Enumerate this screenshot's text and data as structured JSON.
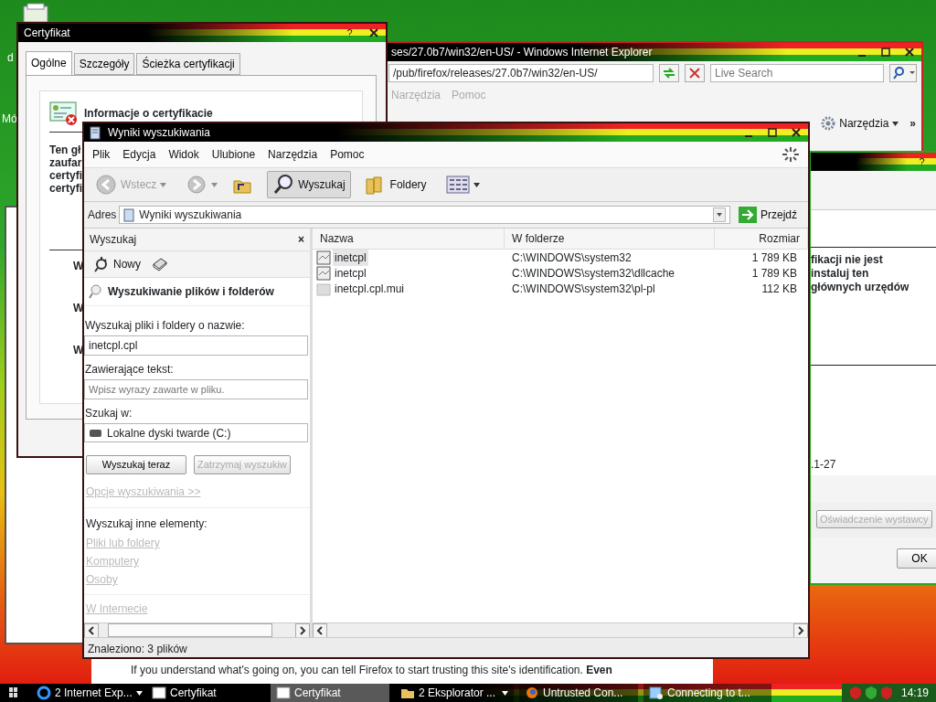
{
  "desktop": {
    "icon_labels": [
      "d",
      "Mó"
    ]
  },
  "ie_window": {
    "title": "ses/27.0b7/win32/en-US/ - Windows Internet Explorer",
    "address": "/pub/firefox/releases/27.0b7/win32/en-US/",
    "search_placeholder": "Live Search",
    "menu": [
      {
        "label": "Narzędzia",
        "disabled": true
      },
      {
        "label": "Pomoc",
        "disabled": true
      }
    ],
    "tools_button": "Narzędzia",
    "chevron": "»"
  },
  "cert_right": {
    "help": "?",
    "text_lines": [
      "fikacji nie jest",
      "instaluj ten",
      "głównych urzędów"
    ],
    "date": ".1-27",
    "issuer_button": "Oświadczenie wystawcy",
    "ok_button": "OK"
  },
  "cert_window": {
    "title": "Certyfikat",
    "help": "?",
    "tabs": [
      {
        "label": "Ogólne",
        "selected": true
      },
      {
        "label": "Szczegóły",
        "selected": false
      },
      {
        "label": "Ścieżka certyfikacji",
        "selected": false
      }
    ],
    "heading": "Informacje o certyfikacie",
    "text_lines": [
      "Ten gł",
      "zaufar",
      "certyfi",
      "certyfi"
    ],
    "field_labels": [
      "W",
      "W",
      "W"
    ]
  },
  "search_window": {
    "title": "Wyniki wyszukiwania",
    "menu": [
      "Plik",
      "Edycja",
      "Widok",
      "Ulubione",
      "Narzędzia",
      "Pomoc"
    ],
    "toolbar": [
      {
        "kind": "back",
        "label": "Wstecz",
        "disabled": true,
        "selected": false
      },
      {
        "kind": "forward",
        "disabled": true,
        "selected": false
      },
      {
        "kind": "up",
        "disabled": false,
        "selected": false
      },
      {
        "kind": "search",
        "label": "Wyszukaj",
        "disabled": false,
        "selected": true
      },
      {
        "kind": "folders",
        "label": "Foldery",
        "disabled": false,
        "selected": false
      },
      {
        "kind": "views",
        "disabled": false,
        "selected": false
      }
    ],
    "address_label": "Adres",
    "address": "Wyniki wyszukiwania",
    "go_button": "Przejdź",
    "pane": {
      "title": "Wyszukaj",
      "close": "×",
      "new_button": "Nowy",
      "heading": "Wyszukiwanie plików i folderów",
      "name_label": "Wyszukaj pliki i foldery o nazwie:",
      "name_value": "inetcpl.cpl",
      "text_label": "Zawierające tekst:",
      "text_placeholder": "Wpisz wyrazy zawarte w pliku.",
      "look_in_label": "Szukaj w:",
      "look_in_value": "Lokalne dyski twarde (C:)",
      "search_button": {
        "label": "Wyszukaj teraz",
        "disabled": false
      },
      "stop_button": {
        "label": "Zatrzymaj wyszukiw",
        "disabled": true
      },
      "options_link": {
        "label": "Opcje wyszukiwania >>",
        "disabled": true
      },
      "other_label": "Wyszukaj inne elementy:",
      "other_links": [
        {
          "label": "Pliki lub foldery",
          "disabled": true
        },
        {
          "label": "Komputery",
          "disabled": true
        },
        {
          "label": "Osoby",
          "disabled": true
        }
      ],
      "internet_link": {
        "label": "W Internecie",
        "disabled": true
      }
    },
    "table": {
      "columns": [
        "Nazwa",
        "W folderze",
        "Rozmiar"
      ],
      "rows": [
        {
          "name": "inetcpl",
          "folder": "C:\\WINDOWS\\system32",
          "size": "1 789 KB",
          "kind": "cpl",
          "selected": true
        },
        {
          "name": "inetcpl",
          "folder": "C:\\WINDOWS\\system32\\dllcache",
          "size": "1 789 KB",
          "kind": "cpl",
          "selected": false
        },
        {
          "name": "inetcpl.cpl.mui",
          "folder": "C:\\WINDOWS\\system32\\pl-pl",
          "size": "112 KB",
          "kind": "mui",
          "selected": false
        }
      ]
    },
    "status_bar": "Znaleziono: 3 plików"
  },
  "firefox_page": {
    "text": "If you understand what's going on, you can tell Firefox to start trusting this site's identification. **Even**"
  },
  "taskbar": {
    "buttons": [
      {
        "label": "2 Internet Exp...",
        "kind": "ie",
        "grouped": true,
        "selected": false
      },
      {
        "label": "Certyfikat",
        "kind": "window",
        "grouped": false,
        "selected": false
      },
      {
        "label": "Certyfikat",
        "kind": "window",
        "grouped": false,
        "selected": true
      },
      {
        "label": "2 Eksplorator ...",
        "kind": "folder",
        "grouped": true,
        "selected": false
      },
      {
        "label": "Untrusted Con...",
        "kind": "firefox",
        "grouped": false,
        "selected": false
      },
      {
        "label": "Connecting to t...",
        "kind": "network",
        "grouped": false,
        "selected": false
      }
    ],
    "clock": "14:19"
  }
}
